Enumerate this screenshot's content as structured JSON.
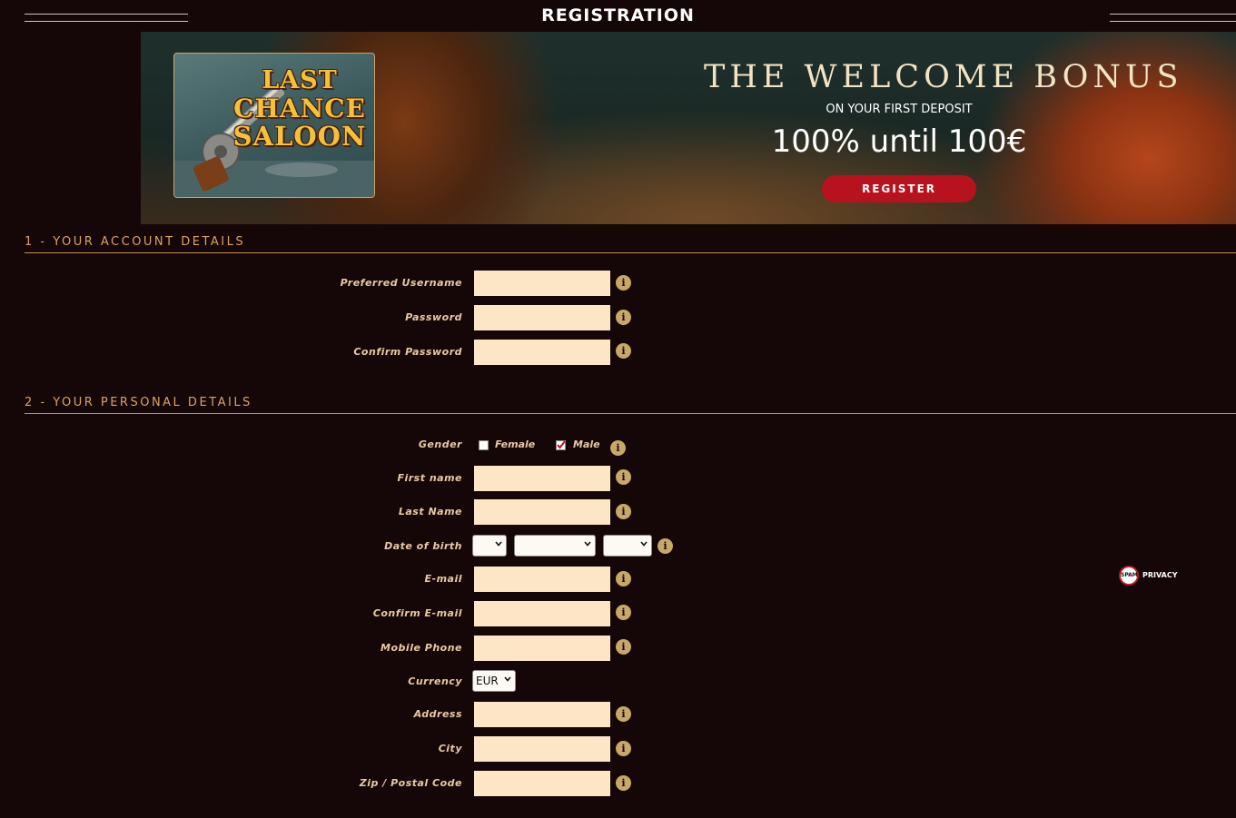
{
  "page": {
    "title": "REGISTRATION"
  },
  "banner": {
    "game_logo": {
      "line1": "LAST",
      "line2": "CHANCE",
      "line3": "SALOON",
      "icon": "revolver-icon"
    },
    "bonus_title": "THE WELCOME BONUS",
    "bonus_subtitle": "ON YOUR FIRST DEPOSIT",
    "bonus_amount": "100% until 100€",
    "register_label": "REGISTER"
  },
  "sections": {
    "account": {
      "heading": "1 - YOUR ACCOUNT DETAILS",
      "fields": {
        "username": {
          "label": "Preferred Username",
          "value": ""
        },
        "password": {
          "label": "Password",
          "value": ""
        },
        "confirm_password": {
          "label": "Confirm  Password",
          "value": ""
        }
      }
    },
    "personal": {
      "heading": "2 - YOUR PERSONAL DETAILS",
      "gender": {
        "label": "Gender",
        "options": [
          {
            "label": "Female",
            "checked": false
          },
          {
            "label": "Male",
            "checked": true
          }
        ]
      },
      "fields": {
        "first_name": {
          "label": "First name",
          "value": ""
        },
        "last_name": {
          "label": "Last Name",
          "value": ""
        },
        "dob": {
          "label": "Date of birth",
          "day": "",
          "month": "",
          "year": ""
        },
        "email": {
          "label": "E-mail",
          "value": ""
        },
        "confirm_email": {
          "label": "Confirm E-mail",
          "value": ""
        },
        "mobile": {
          "label": "Mobile Phone",
          "value": ""
        },
        "currency": {
          "label": "Currency",
          "value": "EUR"
        },
        "address": {
          "label": "Address",
          "value": ""
        },
        "city": {
          "label": "City",
          "value": ""
        },
        "zip": {
          "label": "Zip / Postal Code",
          "value": ""
        }
      }
    }
  },
  "spam_badge": {
    "circle_text": "SPAM",
    "label": "PRIVACY"
  },
  "colors": {
    "background": "#150608",
    "accent": "#d9a263",
    "input_bg": "#fde6c6",
    "register_button": "#b8121e",
    "info_icon": "#c8a868"
  }
}
